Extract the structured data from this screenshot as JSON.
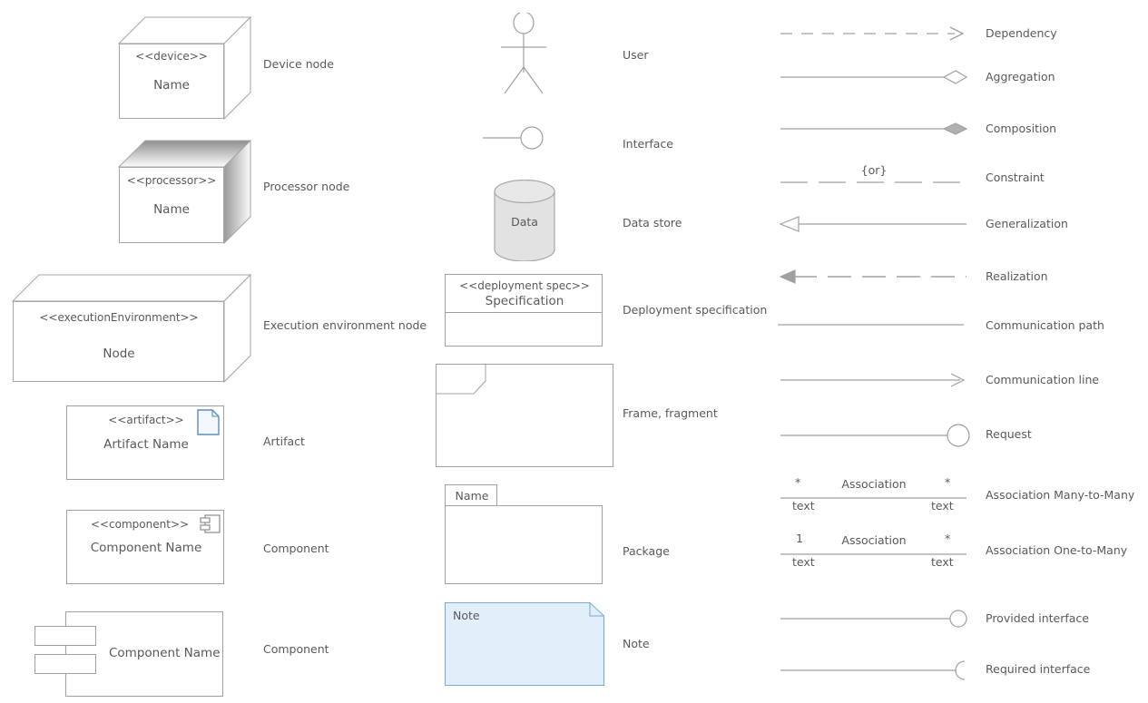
{
  "diagram": {
    "title": "UML Deployment Diagram Notation / Legend",
    "colors": {
      "stroke": "#a0a0a0",
      "text": "#595959",
      "artifact_icon": "#5b8bc4",
      "note_fill": "#e1effa",
      "note_stroke": "#7aa9d6",
      "datastore_fill": "#e2e2e2",
      "composition_fill": "#b0b0b0"
    }
  },
  "column_left": {
    "items": [
      {
        "key": "device-node",
        "label": "Device node",
        "stereotype": "<<device>>",
        "name": "Name"
      },
      {
        "key": "processor-node",
        "label": "Processor node",
        "stereotype": "<<processor>>",
        "name": "Name"
      },
      {
        "key": "execution-environment-node",
        "label": "Execution environment node",
        "stereotype": "<<executionEnvironment>>",
        "name": "Node"
      },
      {
        "key": "artifact",
        "label": "Artifact",
        "stereotype": "<<artifact>>",
        "name": "Artifact Name",
        "icon": "document-icon"
      },
      {
        "key": "component",
        "label": "Component",
        "stereotype": "<<component>>",
        "name": "Component Name",
        "icon": "component-icon"
      },
      {
        "key": "component-ports",
        "label": "Component",
        "name": "Component Name"
      }
    ]
  },
  "column_middle": {
    "items": [
      {
        "key": "user",
        "label": "User",
        "icon": "actor-icon"
      },
      {
        "key": "interface",
        "label": "Interface",
        "icon": "lollipop-icon"
      },
      {
        "key": "data-store",
        "label": "Data store",
        "name": "Data",
        "icon": "cylinder-icon"
      },
      {
        "key": "deployment-specification",
        "label": "Deployment specification",
        "stereotype": "<<deployment spec>>",
        "name": "Specification"
      },
      {
        "key": "frame-fragment",
        "label": "Frame, fragment"
      },
      {
        "key": "package",
        "label": "Package",
        "name": "Name"
      },
      {
        "key": "note",
        "label": "Note",
        "name": "Note"
      }
    ]
  },
  "column_right": {
    "items": [
      {
        "key": "dependency",
        "label": "Dependency"
      },
      {
        "key": "aggregation",
        "label": "Aggregation"
      },
      {
        "key": "composition",
        "label": "Composition"
      },
      {
        "key": "constraint",
        "label": "Constraint",
        "annotation": "{or}"
      },
      {
        "key": "generalization",
        "label": "Generalization"
      },
      {
        "key": "realization",
        "label": "Realization"
      },
      {
        "key": "communication-path",
        "label": "Communication path"
      },
      {
        "key": "communication-line",
        "label": "Communication line"
      },
      {
        "key": "request",
        "label": "Request"
      },
      {
        "key": "association-many-to-many",
        "label": "Association Many-to-Many",
        "name": "Association",
        "source_multiplicity": "*",
        "target_multiplicity": "*",
        "source_role": "text",
        "target_role": "text"
      },
      {
        "key": "association-one-to-many",
        "label": "Association One-to-Many",
        "name": "Association",
        "source_multiplicity": "1",
        "target_multiplicity": "*",
        "source_role": "text",
        "target_role": "text"
      },
      {
        "key": "provided-interface",
        "label": "Provided interface"
      },
      {
        "key": "required-interface",
        "label": "Required interface"
      }
    ]
  }
}
